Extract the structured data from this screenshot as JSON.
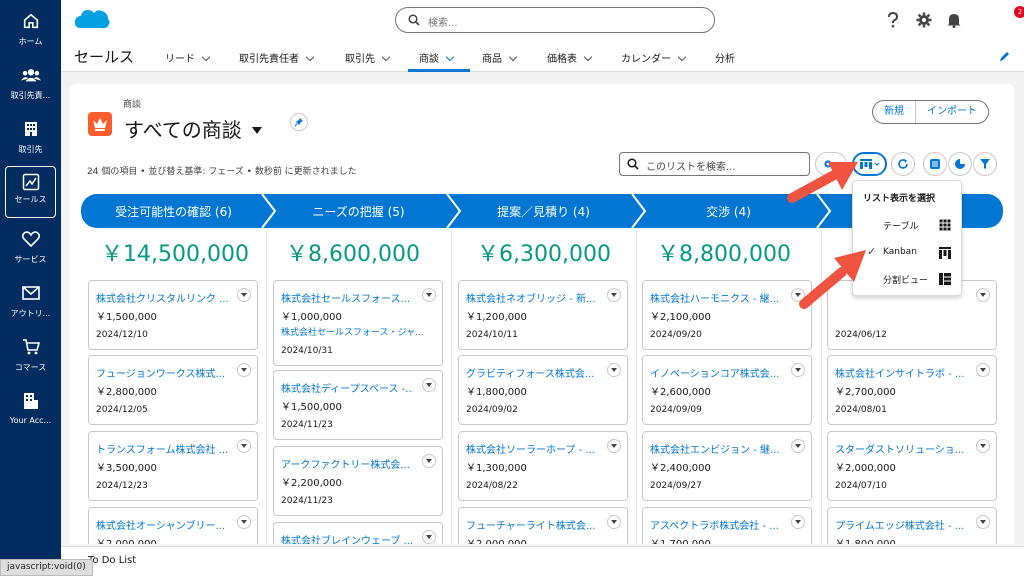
{
  "rail": [
    {
      "icon": "home-icon",
      "label": "ホーム"
    },
    {
      "icon": "people-icon",
      "label": "取引先責..."
    },
    {
      "icon": "building-icon",
      "label": "取引先"
    },
    {
      "icon": "chart-icon",
      "label": "セールス"
    },
    {
      "icon": "heart-icon",
      "label": "サービス"
    },
    {
      "icon": "mail-icon",
      "label": "アウトリ..."
    },
    {
      "icon": "cart-icon",
      "label": "コマース"
    },
    {
      "icon": "account-icon",
      "label": "Your Acc..."
    }
  ],
  "header": {
    "search_placeholder": "検索...",
    "notification_count": "2"
  },
  "nav": {
    "app_name": "セールス",
    "tabs": [
      "リード",
      "取引先責任者",
      "取引先",
      "商談",
      "商品",
      "価格表",
      "カレンダー",
      "分析"
    ],
    "active_tab": "商談"
  },
  "page": {
    "object_label": "商談",
    "title": "すべての商談",
    "buttons": [
      "新規",
      "インポート"
    ],
    "list_info": "24 個の項目 • 並び替え基準: フェーズ • 数秒前 に更新されました",
    "list_search_placeholder": "このリストを検索..."
  },
  "stages": [
    {
      "label": "受注可能性の確認 (6)",
      "total": "￥14,500,000",
      "cards": [
        {
          "name": "株式会社クリスタルリンク ...",
          "amount": "￥1,500,000",
          "date": "2024/12/10"
        },
        {
          "name": "フュージョンワークス株式...",
          "amount": "￥2,800,000",
          "date": "2024/12/05"
        },
        {
          "name": "トランスフォーム株式会社 ...",
          "amount": "￥3,500,000",
          "date": "2024/12/23"
        },
        {
          "name": "株式会社オーシャンブリー...",
          "amount": "￥2,000,000",
          "date": ""
        }
      ]
    },
    {
      "label": "ニーズの把握 (5)",
      "total": "￥8,600,000",
      "cards": [
        {
          "name": "株式会社セールスフォース...",
          "amount": "￥1,000,000",
          "sub": "株式会社セールスフォース・ジャ...",
          "date": "2024/10/31"
        },
        {
          "name": "株式会社ディープスペース -...",
          "amount": "￥1,500,000",
          "date": "2024/11/23"
        },
        {
          "name": "アークファクトリー株式会...",
          "amount": "￥2,200,000",
          "date": "2024/11/23"
        },
        {
          "name": "株式会社ブレインウェーブ ...",
          "amount": "",
          "date": ""
        }
      ]
    },
    {
      "label": "提案／見積り (4)",
      "total": "￥6,300,000",
      "cards": [
        {
          "name": "株式会社ネオブリッジ - 新...",
          "amount": "￥1,200,000",
          "date": "2024/10/11"
        },
        {
          "name": "グラビティフォース株式会...",
          "amount": "￥1,800,000",
          "date": "2024/09/02"
        },
        {
          "name": "株式会社ソーラーホープ - ...",
          "amount": "￥1,300,000",
          "date": "2024/08/22"
        },
        {
          "name": "フューチャーライト株式会...",
          "amount": "￥2,000,000",
          "date": ""
        }
      ]
    },
    {
      "label": "交渉 (4)",
      "total": "￥8,800,000",
      "cards": [
        {
          "name": "株式会社ハーモニクス - 継...",
          "amount": "￥2,100,000",
          "date": "2024/09/20"
        },
        {
          "name": "イノベーションコア株式会...",
          "amount": "￥2,600,000",
          "date": "2024/09/09"
        },
        {
          "name": "株式会社エンビジョン - 継...",
          "amount": "￥2,400,000",
          "date": "2024/09/27"
        },
        {
          "name": "アスペクトラボ株式会社 - ...",
          "amount": "￥1,700,000",
          "date": ""
        }
      ]
    },
    {
      "label": "",
      "total": "",
      "cards": [
        {
          "name": "",
          "amount": "",
          "date": "2024/06/12"
        },
        {
          "name": "株式会社インサイトラボ - ...",
          "amount": "￥2,700,000",
          "date": "2024/08/01"
        },
        {
          "name": "スターダストソリューショ...",
          "amount": "￥2,000,000",
          "date": "2024/07/10"
        },
        {
          "name": "プライムエッジ株式会社 - ...",
          "amount": "￥1,800,000",
          "date": ""
        }
      ]
    }
  ],
  "dropdown": {
    "header": "リスト表示を選択",
    "items": [
      {
        "label": "テーブル",
        "icon": "table-icon",
        "checked": false
      },
      {
        "label": "Kanban",
        "icon": "kanban-icon",
        "checked": true
      },
      {
        "label": "分割ビュー",
        "icon": "split-view-icon",
        "checked": false
      }
    ]
  },
  "footer": {
    "todo_label": "To Do List",
    "status_text": "javascript:void(0)"
  },
  "colors": {
    "brand": "#0176d3",
    "rail": "#032d60",
    "total": "#079a82",
    "opportunity": "#ff5d2d",
    "annotation_arrow": "#f0533f"
  }
}
